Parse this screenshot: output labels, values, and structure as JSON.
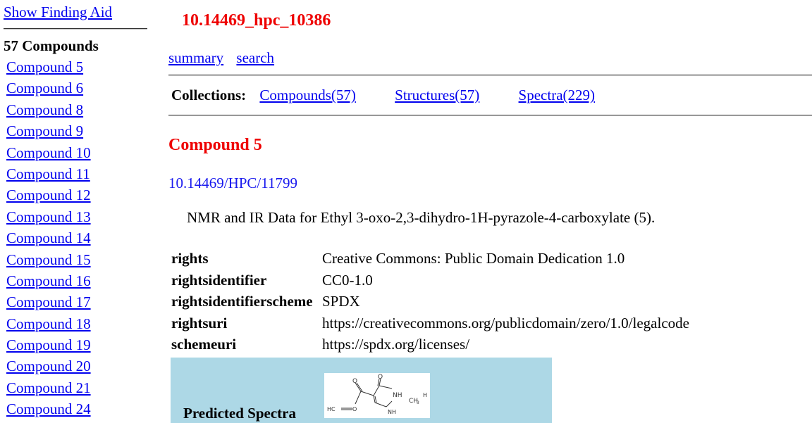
{
  "sidebar": {
    "finding_aid_label": "Show Finding Aid",
    "count_label": "57 Compounds",
    "items": [
      {
        "label": "Compound 5"
      },
      {
        "label": "Compound 6"
      },
      {
        "label": "Compound 8"
      },
      {
        "label": "Compound 9"
      },
      {
        "label": "Compound 10"
      },
      {
        "label": "Compound 11"
      },
      {
        "label": "Compound 12"
      },
      {
        "label": "Compound 13"
      },
      {
        "label": "Compound 14"
      },
      {
        "label": "Compound 15"
      },
      {
        "label": "Compound 16"
      },
      {
        "label": "Compound 17"
      },
      {
        "label": "Compound 18"
      },
      {
        "label": "Compound 19"
      },
      {
        "label": "Compound 20"
      },
      {
        "label": "Compound 21"
      },
      {
        "label": "Compound 24"
      }
    ]
  },
  "header": {
    "record_id": "10.14469_hpc_10386",
    "links": {
      "summary": "summary",
      "search": "search"
    }
  },
  "collections": {
    "label": "Collections:",
    "compounds": "Compounds(57)",
    "structures": "Structures(57)",
    "spectra": "Spectra(229)"
  },
  "compound": {
    "title": "Compound 5",
    "doi": "10.14469/HPC/11799",
    "description": "NMR and IR Data for Ethyl 3-oxo-2,3-dihydro-1H-pyrazole-4-carboxylate (5)."
  },
  "metadata": [
    {
      "key": "rights",
      "value": "Creative Commons: Public Domain Dedication 1.0"
    },
    {
      "key": "rightsidentifier",
      "value": "CC0-1.0"
    },
    {
      "key": "rightsidentifierscheme",
      "value": "SPDX"
    },
    {
      "key": "rightsuri",
      "value": "https://creativecommons.org/publicdomain/zero/1.0/legalcode"
    },
    {
      "key": "schemeuri",
      "value": "https://spdx.org/licenses/"
    }
  ],
  "spectra": {
    "label": "Predicted Spectra",
    "structure_labels": {
      "o": "O",
      "nh": "NH",
      "ch3": "CH",
      "sub3": "3",
      "h": "H",
      "hc": "HC",
      "o2": "O",
      "nh2": "NH"
    }
  },
  "colors": {
    "title_red": "#ee0000",
    "link_blue": "#0000ee",
    "spectra_bg": "#add8e6"
  }
}
